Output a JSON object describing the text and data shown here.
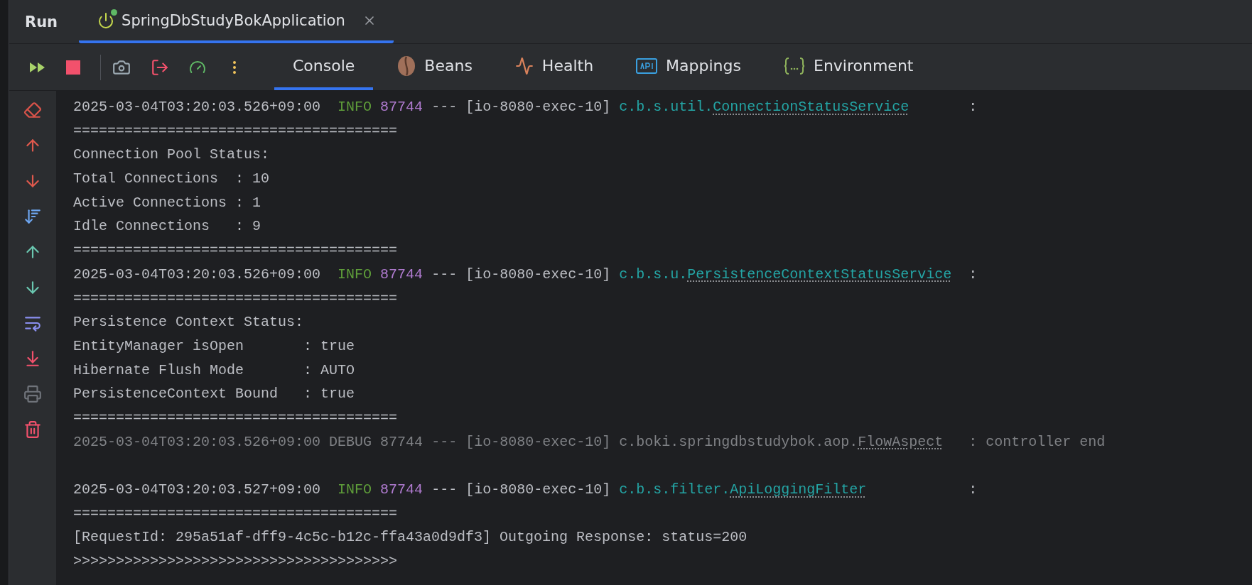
{
  "header": {
    "title": "Run",
    "run_tabs": [
      {
        "label": "SpringDbStudyBokApplication",
        "selected": true,
        "running": true
      }
    ]
  },
  "tool_tabs": [
    {
      "label": "Console",
      "selected": true,
      "kind": "console"
    },
    {
      "label": "Beans",
      "selected": false,
      "kind": "beans"
    },
    {
      "label": "Health",
      "selected": false,
      "kind": "health"
    },
    {
      "label": "Mappings",
      "selected": false,
      "kind": "mappings"
    },
    {
      "label": "Environment",
      "selected": false,
      "kind": "environment"
    }
  ],
  "console": {
    "lines": [
      {
        "kind": "log",
        "dimmed": false,
        "timestamp": "2025-03-04T03:20:03.526+09:00",
        "level": "INFO",
        "pid": "87744",
        "separator": "---",
        "thread": "[io-8080-exec-10]",
        "logger_package": "c.b.s.util.",
        "logger_class": "ConnectionStatusService",
        "colon": ":"
      },
      {
        "kind": "text",
        "text": "======================================"
      },
      {
        "kind": "text",
        "text": "Connection Pool Status:"
      },
      {
        "kind": "text",
        "text": "Total Connections  : 10"
      },
      {
        "kind": "text",
        "text": "Active Connections : 1"
      },
      {
        "kind": "text",
        "text": "Idle Connections   : 9"
      },
      {
        "kind": "text",
        "text": "======================================"
      },
      {
        "kind": "log",
        "dimmed": false,
        "timestamp": "2025-03-04T03:20:03.526+09:00",
        "level": "INFO",
        "pid": "87744",
        "separator": "---",
        "thread": "[io-8080-exec-10]",
        "logger_package": "c.b.s.u.",
        "logger_class": "PersistenceContextStatusService",
        "colon": ":"
      },
      {
        "kind": "text",
        "text": "======================================"
      },
      {
        "kind": "text",
        "text": "Persistence Context Status:"
      },
      {
        "kind": "text",
        "text": "EntityManager isOpen       : true"
      },
      {
        "kind": "text",
        "text": "Hibernate Flush Mode       : AUTO"
      },
      {
        "kind": "text",
        "text": "PersistenceContext Bound   : true"
      },
      {
        "kind": "text",
        "text": "======================================"
      },
      {
        "kind": "log",
        "dimmed": true,
        "timestamp": "2025-03-04T03:20:03.526+09:00",
        "level": "DEBUG",
        "pid": "87744",
        "separator": "---",
        "thread": "[io-8080-exec-10]",
        "logger_package": "c.boki.springdbstudybok.aop.",
        "logger_class": "FlowAspect",
        "colon": ":",
        "message": "controller end"
      },
      {
        "kind": "blank"
      },
      {
        "kind": "log",
        "dimmed": false,
        "timestamp": "2025-03-04T03:20:03.527+09:00",
        "level": "INFO",
        "pid": "87744",
        "separator": "---",
        "thread": "[io-8080-exec-10]",
        "logger_package": "c.b.s.filter.",
        "logger_class": "ApiLoggingFilter",
        "colon": ":"
      },
      {
        "kind": "text",
        "text": "======================================"
      },
      {
        "kind": "text",
        "text": "[RequestId: 295a51af-dff9-4c5c-b12c-ffa43a0d9df3] Outgoing Response: status=200"
      },
      {
        "kind": "text",
        "text": ">>>>>>>>>>>>>>>>>>>>>>>>>>>>>>>>>>>>>>"
      }
    ]
  }
}
